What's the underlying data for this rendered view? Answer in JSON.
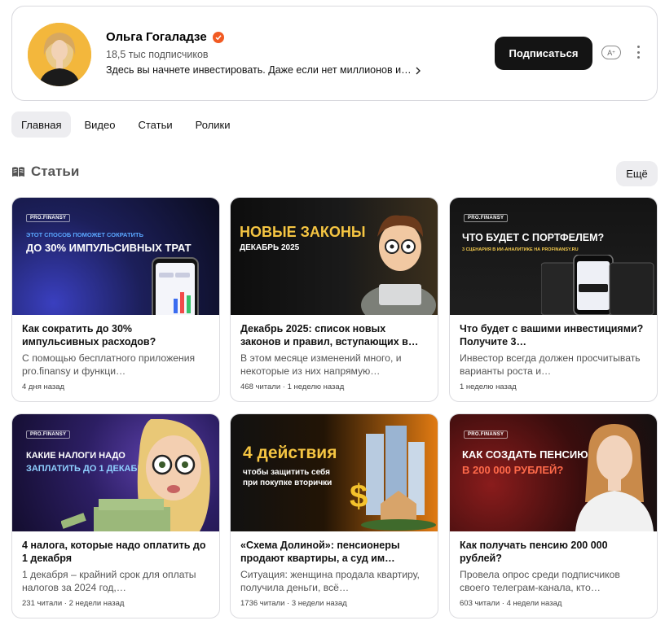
{
  "channel": {
    "name": "Ольга Гогаладзе",
    "subscribers": "18,5 тыс подписчиков",
    "description": "Здесь вы начнете инвестировать. Даже если нет миллионов и…",
    "subscribe_label": "Подписаться",
    "verified_icon": "verified-check-icon",
    "translate_icon_label": "A",
    "colors": {
      "verified": "#f15a22",
      "subscribe_bg": "#141414",
      "avatar_bg": "#f3b73c"
    }
  },
  "tabs": [
    {
      "label": "Главная",
      "active": true
    },
    {
      "label": "Видео",
      "active": false
    },
    {
      "label": "Статьи",
      "active": false
    },
    {
      "label": "Ролики",
      "active": false
    }
  ],
  "section": {
    "title": "Статьи",
    "icon": "articles-icon",
    "more_label": "Ещё"
  },
  "articles": [
    {
      "title": "Как сократить до 30% импульсивных расходов?",
      "snippet": "С помощью бесплатного приложения pro.finansy и функци…",
      "meta": "4 дня назад",
      "thumb": {
        "brand": "PRO.FINANSY",
        "line1": "ЭТОТ СПОСОБ ПОМОЖЕТ СОКРАТИТЬ",
        "line2": "ДО 30% ИМПУЛЬСИВНЫХ ТРАТ"
      }
    },
    {
      "title": "Декабрь 2025: список новых законов и правил, вступающих в…",
      "snippet": "В этом месяце изменений много, и некоторые из них напрямую…",
      "meta": "468 читали · 1 неделю назад",
      "thumb": {
        "line1": "НОВЫЕ ЗАКОНЫ",
        "line2": "ДЕКАБРЬ 2025"
      }
    },
    {
      "title": "Что будет с вашими инвестициями? Получите 3…",
      "snippet": "Инвестор всегда должен просчитывать варианты роста и…",
      "meta": "1 неделю назад",
      "thumb": {
        "brand": "PRO.FINANSY",
        "line1": "ЧТО БУДЕТ С ПОРТФЕЛЕМ?",
        "line2": "3 СЦЕНАРИЯ В ИИ-АНАЛИТИКЕ НА PROFINANSY.RU"
      }
    },
    {
      "title": "4 налога, которые надо оплатить до 1 декабря",
      "snippet": "1 декабря – крайний срок для оплаты налогов за 2024 год,…",
      "meta": "231 читали · 2 недели назад",
      "thumb": {
        "brand": "PRO.FINANSY",
        "line1": "КАКИЕ НАЛОГИ НАДО",
        "line2": "ЗАПЛАТИТЬ ДО 1 ДЕКАБРЯ?"
      }
    },
    {
      "title": "«Схема Долиной»: пенсионеры продают квартиры, а суд им…",
      "snippet": "Ситуация: женщина продала квартиру, получила деньги, всё…",
      "meta": "1736 читали · 3 недели назад",
      "thumb": {
        "line1": "4 действия",
        "line2": "чтобы защитить себя",
        "line3": "при покупке вторички"
      }
    },
    {
      "title": "Как получать пенсию 200 000 рублей?",
      "snippet": "Провела опрос среди подписчиков своего телеграм-канала, кто…",
      "meta": "603 читали · 4 недели назад",
      "thumb": {
        "brand": "PRO.FINANSY",
        "line1": "КАК СОЗДАТЬ ПЕНСИЮ",
        "line2": "В 200 000 РУБЛЕЙ?"
      }
    }
  ]
}
